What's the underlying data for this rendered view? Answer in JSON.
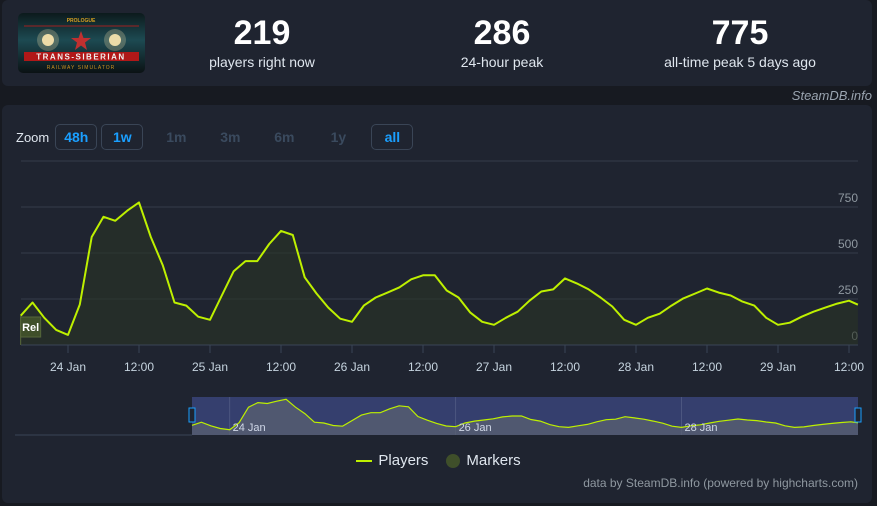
{
  "game": {
    "logo_text": [
      "PROLOGUE",
      "TRANS-SIBERIAN",
      "RAILWAY SIMULATOR"
    ]
  },
  "stats": [
    {
      "value": "219",
      "label": "players right now"
    },
    {
      "value": "286",
      "label": "24-hour peak"
    },
    {
      "value": "775",
      "label": "all-time peak 5 days ago"
    }
  ],
  "brand": "SteamDB.info",
  "zoom": {
    "label": "Zoom",
    "buttons": [
      {
        "label": "48h",
        "active": true
      },
      {
        "label": "1w",
        "active": true
      },
      {
        "label": "1m",
        "active": false
      },
      {
        "label": "3m",
        "active": false
      },
      {
        "label": "6m",
        "active": false
      },
      {
        "label": "1y",
        "active": false
      },
      {
        "label": "all",
        "active": true
      }
    ]
  },
  "chart_data": {
    "type": "line",
    "series": [
      {
        "name": "Players",
        "color": "#bef000",
        "points": [
          [
            "Jan 23 16:00",
            159
          ],
          [
            "Jan 23 18:00",
            231
          ],
          [
            "Jan 23 20:00",
            148
          ],
          [
            "Jan 23 22:00",
            82
          ],
          [
            "Jan 24 00:00",
            55
          ],
          [
            "Jan 24 02:00",
            220
          ],
          [
            "Jan 24 04:00",
            587
          ],
          [
            "Jan 24 06:00",
            697
          ],
          [
            "Jan 24 08:00",
            675
          ],
          [
            "Jan 24 10:00",
            730
          ],
          [
            "Jan 24 12:00",
            775
          ],
          [
            "Jan 24 14:00",
            587
          ],
          [
            "Jan 24 16:00",
            434
          ],
          [
            "Jan 24 18:00",
            231
          ],
          [
            "Jan 24 20:00",
            214
          ],
          [
            "Jan 24 22:00",
            154
          ],
          [
            "Jan 25 00:00",
            137
          ],
          [
            "Jan 25 02:00",
            269
          ],
          [
            "Jan 25 04:00",
            401
          ],
          [
            "Jan 25 06:00",
            456
          ],
          [
            "Jan 25 08:00",
            456
          ],
          [
            "Jan 25 10:00",
            549
          ],
          [
            "Jan 25 12:00",
            620
          ],
          [
            "Jan 25 14:00",
            598
          ],
          [
            "Jan 25 16:00",
            368
          ],
          [
            "Jan 25 18:00",
            280
          ],
          [
            "Jan 25 20:00",
            203
          ],
          [
            "Jan 25 22:00",
            143
          ],
          [
            "Jan 26 00:00",
            126
          ],
          [
            "Jan 26 02:00",
            214
          ],
          [
            "Jan 26 04:00",
            258
          ],
          [
            "Jan 26 06:00",
            285
          ],
          [
            "Jan 26 08:00",
            313
          ],
          [
            "Jan 26 10:00",
            357
          ],
          [
            "Jan 26 12:00",
            379
          ],
          [
            "Jan 26 14:00",
            379
          ],
          [
            "Jan 26 16:00",
            296
          ],
          [
            "Jan 26 18:00",
            258
          ],
          [
            "Jan 26 20:00",
            176
          ],
          [
            "Jan 26 22:00",
            126
          ],
          [
            "Jan 27 00:00",
            110
          ],
          [
            "Jan 27 02:00",
            148
          ],
          [
            "Jan 27 04:00",
            181
          ],
          [
            "Jan 27 06:00",
            241
          ],
          [
            "Jan 27 08:00",
            291
          ],
          [
            "Jan 27 10:00",
            302
          ],
          [
            "Jan 27 12:00",
            362
          ],
          [
            "Jan 27 14:00",
            335
          ],
          [
            "Jan 27 16:00",
            302
          ],
          [
            "Jan 27 18:00",
            258
          ],
          [
            "Jan 27 20:00",
            209
          ],
          [
            "Jan 27 22:00",
            137
          ],
          [
            "Jan 28 00:00",
            110
          ],
          [
            "Jan 28 02:00",
            148
          ],
          [
            "Jan 28 04:00",
            170
          ],
          [
            "Jan 28 06:00",
            214
          ],
          [
            "Jan 28 08:00",
            253
          ],
          [
            "Jan 28 10:00",
            280
          ],
          [
            "Jan 28 12:00",
            307
          ],
          [
            "Jan 28 14:00",
            285
          ],
          [
            "Jan 28 16:00",
            269
          ],
          [
            "Jan 28 18:00",
            236
          ],
          [
            "Jan 28 20:00",
            214
          ],
          [
            "Jan 28 22:00",
            148
          ],
          [
            "Jan 29 00:00",
            110
          ],
          [
            "Jan 29 02:00",
            121
          ],
          [
            "Jan 29 04:00",
            154
          ],
          [
            "Jan 29 06:00",
            181
          ],
          [
            "Jan 29 08:00",
            203
          ],
          [
            "Jan 29 10:00",
            225
          ],
          [
            "Jan 29 12:00",
            241
          ],
          [
            "Jan 29 13:30",
            219
          ]
        ]
      }
    ],
    "x_ticks": [
      {
        "label": "24 Jan",
        "t": "Jan 24 00:00"
      },
      {
        "label": "12:00",
        "t": "Jan 24 12:00"
      },
      {
        "label": "25 Jan",
        "t": "Jan 25 00:00"
      },
      {
        "label": "12:00",
        "t": "Jan 25 12:00"
      },
      {
        "label": "26 Jan",
        "t": "Jan 26 00:00"
      },
      {
        "label": "12:00",
        "t": "Jan 26 12:00"
      },
      {
        "label": "27 Jan",
        "t": "Jan 27 00:00"
      },
      {
        "label": "12:00",
        "t": "Jan 27 12:00"
      },
      {
        "label": "28 Jan",
        "t": "Jan 28 00:00"
      },
      {
        "label": "12:00",
        "t": "Jan 28 12:00"
      },
      {
        "label": "29 Jan",
        "t": "Jan 29 00:00"
      },
      {
        "label": "12:00",
        "t": "Jan 29 12:00"
      }
    ],
    "y_ticks": [
      "0",
      "250",
      "500",
      "750"
    ],
    "ylim": [
      0,
      1000
    ],
    "grid": true,
    "markers": [
      {
        "label": "Rel",
        "t": "Jan 23 16:00"
      }
    ],
    "navigator_ticks": [
      {
        "label": "24 Jan",
        "t": "Jan 24 00:00"
      },
      {
        "label": "26 Jan",
        "t": "Jan 26 00:00"
      },
      {
        "label": "28 Jan",
        "t": "Jan 28 00:00"
      }
    ],
    "legend": [
      {
        "label": "Players",
        "color": "#bef000"
      },
      {
        "label": "Markers",
        "color": "#3f4f2a"
      }
    ],
    "legend_position": "bottom"
  },
  "credits": "data by SteamDB.info (powered by highcharts.com)"
}
